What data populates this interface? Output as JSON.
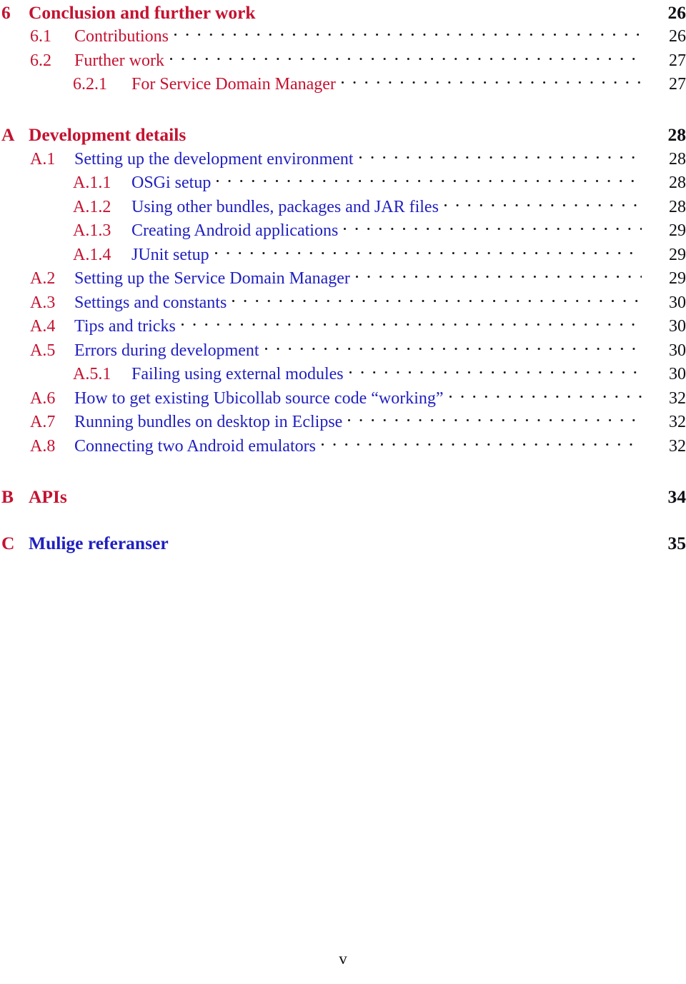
{
  "document": {
    "type": "table-of-contents",
    "folio": "v",
    "colors": {
      "number_red": "#c41230",
      "title_blue": "#2020c0",
      "page_number": "#0e0e14",
      "background": "#ffffff"
    }
  },
  "entries": [
    {
      "level": 0,
      "number": "6",
      "title": "Conclusion and further work",
      "page": "26",
      "title_color": "red",
      "leader": false
    },
    {
      "level": 1,
      "number": "6.1",
      "title": "Contributions",
      "page": "26",
      "title_color": "red",
      "leader": true
    },
    {
      "level": 1,
      "number": "6.2",
      "title": "Further work",
      "page": "27",
      "title_color": "red",
      "leader": true
    },
    {
      "level": 2,
      "number": "6.2.1",
      "title": "For Service Domain Manager",
      "page": "27",
      "title_color": "red",
      "leader": true
    },
    {
      "level": 0,
      "number": "A",
      "title": "Development details",
      "page": "28",
      "title_color": "red",
      "leader": false,
      "gap_before": "lg"
    },
    {
      "level": 1,
      "number": "A.1",
      "title": "Setting up the development environment",
      "page": "28",
      "title_color": "blue",
      "leader": true
    },
    {
      "level": 2,
      "number": "A.1.1",
      "title": "OSGi setup",
      "page": "28",
      "title_color": "blue",
      "leader": true
    },
    {
      "level": 2,
      "number": "A.1.2",
      "title": "Using other bundles, packages and JAR files",
      "page": "28",
      "title_color": "blue",
      "leader": true
    },
    {
      "level": 2,
      "number": "A.1.3",
      "title": "Creating Android applications",
      "page": "29",
      "title_color": "blue",
      "leader": true
    },
    {
      "level": 2,
      "number": "A.1.4",
      "title": "JUnit setup",
      "page": "29",
      "title_color": "blue",
      "leader": true
    },
    {
      "level": 1,
      "number": "A.2",
      "title": "Setting up the Service Domain Manager",
      "page": "29",
      "title_color": "blue",
      "leader": true
    },
    {
      "level": 1,
      "number": "A.3",
      "title": "Settings and constants",
      "page": "30",
      "title_color": "blue",
      "leader": true
    },
    {
      "level": 1,
      "number": "A.4",
      "title": "Tips and tricks",
      "page": "30",
      "title_color": "blue",
      "leader": true
    },
    {
      "level": 1,
      "number": "A.5",
      "title": "Errors during development",
      "page": "30",
      "title_color": "blue",
      "leader": true
    },
    {
      "level": 2,
      "number": "A.5.1",
      "title": "Failing using external modules",
      "page": "30",
      "title_color": "blue",
      "leader": true
    },
    {
      "level": 1,
      "number": "A.6",
      "title": "How to get existing Ubicollab source code “working”",
      "page": "32",
      "title_color": "blue",
      "leader": true
    },
    {
      "level": 1,
      "number": "A.7",
      "title": "Running bundles on desktop in Eclipse",
      "page": "32",
      "title_color": "blue",
      "leader": true
    },
    {
      "level": 1,
      "number": "A.8",
      "title": "Connecting two Android emulators",
      "page": "32",
      "title_color": "blue",
      "leader": true
    },
    {
      "level": 0,
      "number": "B",
      "title": "APIs",
      "page": "34",
      "title_color": "red",
      "leader": false,
      "gap_before": "lg"
    },
    {
      "level": 0,
      "number": "C",
      "title": "Mulige referanser",
      "page": "35",
      "title_color": "blue",
      "leader": false,
      "gap_before": "md"
    }
  ]
}
